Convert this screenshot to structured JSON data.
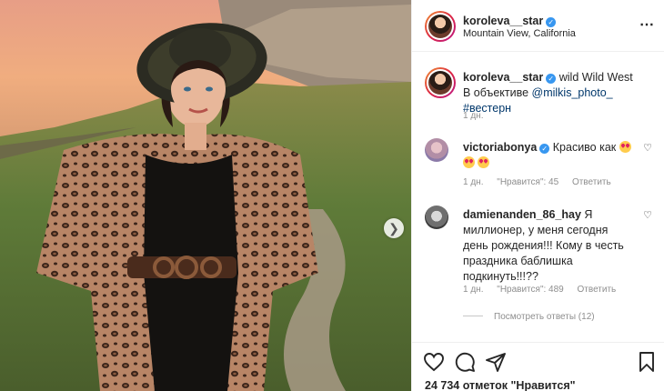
{
  "post": {
    "author": "koroleva__star",
    "location": "Mountain View, California",
    "caption_text": "wild Wild West В объективе ",
    "caption_mention": "@milkis_photo_",
    "caption_hashtag": "#вестерн",
    "caption_time": "1 дн.",
    "more_icon": "⋯"
  },
  "comments": [
    {
      "username": "victoriabonya",
      "text": "Красиво как ",
      "time": "1 дн.",
      "likes": "\"Нравится\": 45",
      "reply": "Ответить"
    },
    {
      "username": "damienanden_86_hay",
      "text": "Я миллионер, у меня сегодня день рождения!!! Кому в честь праздника баблишка подкинуть!!!??",
      "time": "1 дн.",
      "likes": "\"Нравится\": 489",
      "reply": "Ответить"
    }
  ],
  "view_replies": "Посмотреть ответы (12)",
  "likes_count": "24 734 отметок \"Нравится\"",
  "icons": {
    "next": "chevron-right-icon",
    "like": "heart-icon",
    "comment": "comment-icon",
    "share": "share-icon",
    "save": "bookmark-icon"
  }
}
